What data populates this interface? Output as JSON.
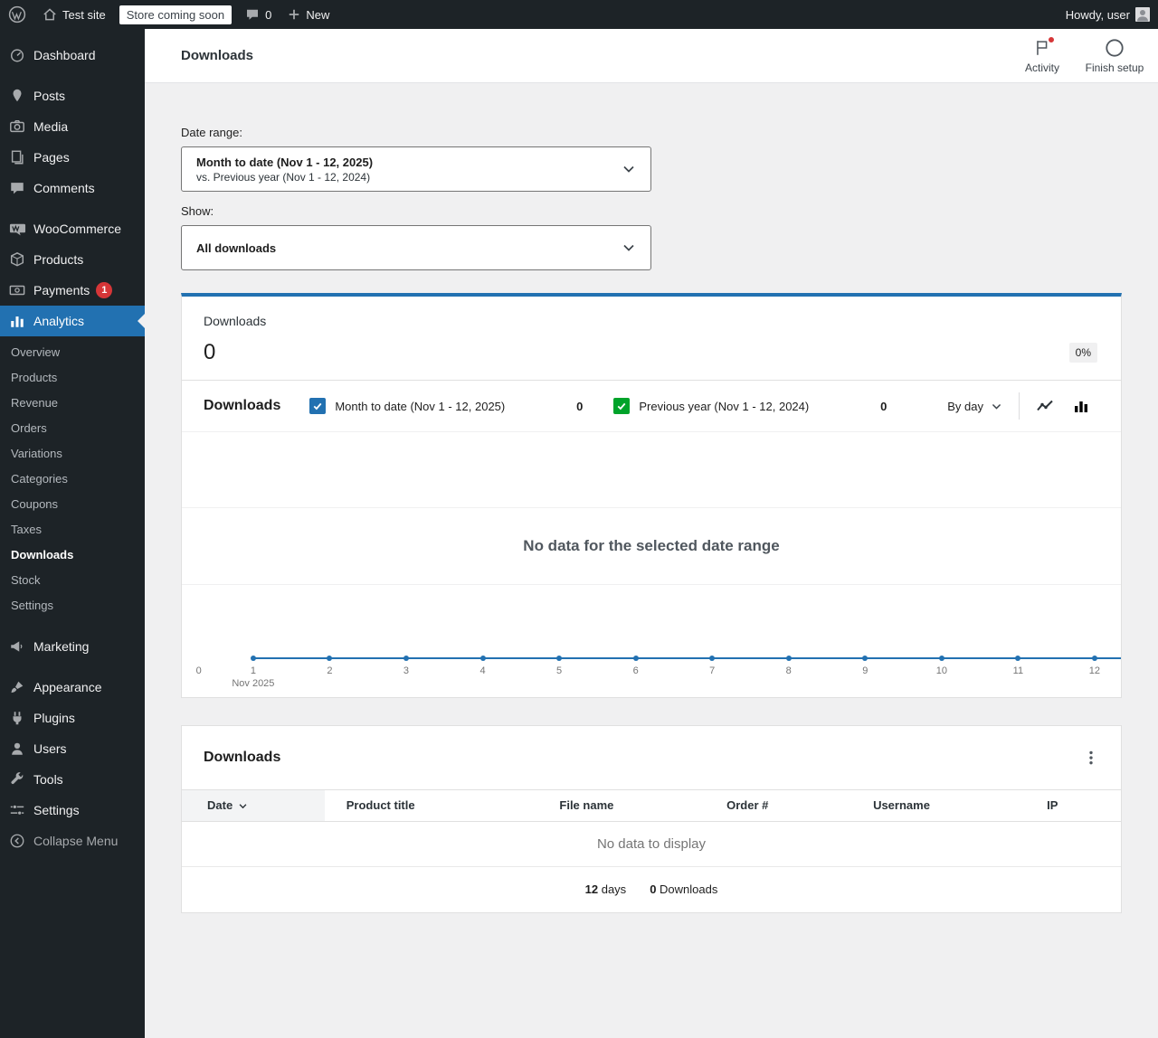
{
  "colors": {
    "accent": "#2271b1",
    "notification_red": "#d63638",
    "admin_bar_bg": "#1d2327",
    "active_menu_bg": "#2271b1"
  },
  "admin_bar": {
    "site_name": "Test site",
    "coming_soon_badge": "Store coming soon",
    "comment_count": "0",
    "new_label": "New",
    "greeting": "Howdy, user"
  },
  "sidebar": {
    "items": [
      "Dashboard",
      "Posts",
      "Media",
      "Pages",
      "Comments",
      "WooCommerce",
      "Products",
      "Payments",
      "Analytics",
      "Marketing",
      "Appearance",
      "Plugins",
      "Users",
      "Tools",
      "Settings",
      "Collapse Menu"
    ],
    "payments_badge": "1",
    "active_item": "Analytics",
    "analytics_submenu": [
      "Overview",
      "Products",
      "Revenue",
      "Orders",
      "Variations",
      "Categories",
      "Coupons",
      "Taxes",
      "Downloads",
      "Stock",
      "Settings"
    ],
    "active_submenu_item": "Downloads"
  },
  "header": {
    "title": "Downloads",
    "activity_label": "Activity",
    "finish_setup_label": "Finish setup"
  },
  "filters": {
    "date_range_label": "Date range:",
    "date_range_value": "Month to date (Nov 1 - 12, 2025)",
    "date_range_compare": "vs. Previous year (Nov 1 - 12, 2024)",
    "show_label": "Show:",
    "show_value": "All downloads"
  },
  "summary": {
    "label": "Downloads",
    "value": "0",
    "delta": "0%"
  },
  "chart": {
    "title": "Downloads",
    "interval_label": "By day"
  },
  "chart_data": {
    "type": "line",
    "title": "Downloads",
    "interval": "By day",
    "x": [
      1,
      2,
      3,
      4,
      5,
      6,
      7,
      8,
      9,
      10,
      11,
      12
    ],
    "x_tick_labels": [
      "0",
      "1",
      "2",
      "3",
      "4",
      "5",
      "6",
      "7",
      "8",
      "9",
      "10",
      "11",
      "12"
    ],
    "x_axis_annotation": "Nov 2025",
    "series": [
      {
        "name": "Month to date (Nov 1 - 12, 2025)",
        "color": "#2271b1",
        "total": 0,
        "checked": true,
        "values": [
          0,
          0,
          0,
          0,
          0,
          0,
          0,
          0,
          0,
          0,
          0,
          0
        ]
      },
      {
        "name": "Previous year (Nov 1 - 12, 2024)",
        "color": "#00a32a",
        "total": 0,
        "checked": true,
        "values": [
          0,
          0,
          0,
          0,
          0,
          0,
          0,
          0,
          0,
          0,
          0,
          0
        ]
      }
    ],
    "ylim": [
      0,
      1
    ],
    "grid": true,
    "legend_position": "top",
    "empty_message": "No data for the selected date range"
  },
  "table": {
    "title": "Downloads",
    "columns": [
      "Date",
      "Product title",
      "File name",
      "Order #",
      "Username",
      "IP"
    ],
    "sorted_column": "Date",
    "rows": [],
    "empty_message": "No data to display",
    "summary": {
      "days_value": "12",
      "days_label": "days",
      "downloads_value": "0",
      "downloads_label": "Downloads"
    }
  }
}
